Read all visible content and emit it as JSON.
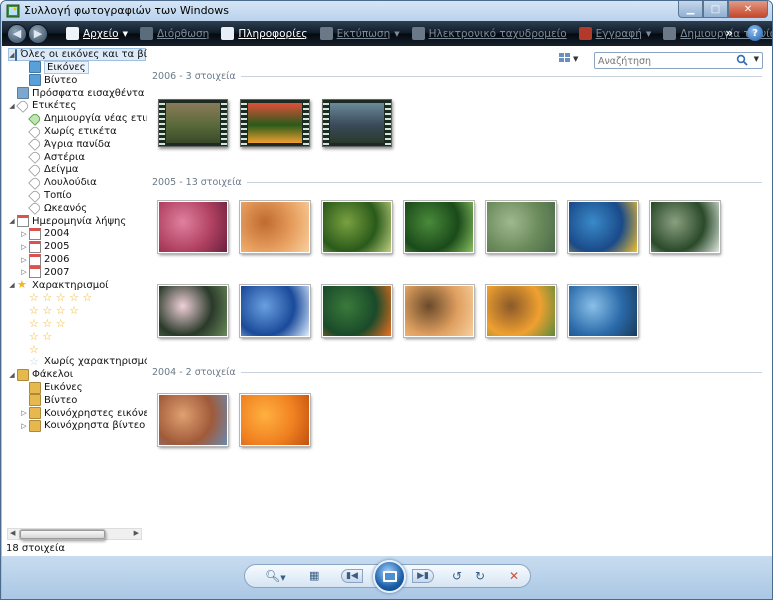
{
  "window": {
    "title": "Συλλογή φωτογραφιών των Windows",
    "controls": [
      "minimize",
      "maximize",
      "close"
    ]
  },
  "toolbar": {
    "items": [
      {
        "label": "Αρχείο",
        "has_dropdown": true,
        "enabled": true,
        "icon": "file-icon"
      },
      {
        "label": "Διόρθωση",
        "has_dropdown": false,
        "enabled": false,
        "icon": "fix-icon"
      },
      {
        "label": "Πληροφορίες",
        "has_dropdown": false,
        "enabled": true,
        "icon": "info-icon"
      },
      {
        "label": "Εκτύπωση",
        "has_dropdown": true,
        "enabled": false,
        "icon": "print-icon"
      },
      {
        "label": "Ηλεκτρονικό ταχυδρομείο",
        "has_dropdown": false,
        "enabled": false,
        "icon": "email-icon"
      },
      {
        "label": "Εγγραφή",
        "has_dropdown": true,
        "enabled": false,
        "icon": "burn-icon"
      },
      {
        "label": "Δημιουργία ταινίας",
        "has_dropdown": false,
        "enabled": false,
        "icon": "movie-icon"
      }
    ],
    "more": "»",
    "help": "?"
  },
  "nav": {
    "rows": [
      {
        "label": "Όλες οι εικόνες και τα βίντεο",
        "level": 0,
        "expander": "▲",
        "icon": "gallery-icon",
        "selected": true
      },
      {
        "label": "Εικόνες",
        "level": 1,
        "icon": "pictures-icon",
        "selected2": true
      },
      {
        "label": "Βίντεο",
        "level": 1,
        "icon": "video-icon"
      },
      {
        "label": "Πρόσφατα εισαχθέντα",
        "level": 0,
        "icon": "recent-icon"
      },
      {
        "label": "Ετικέτες",
        "level": 0,
        "expander": "▲",
        "icon": "tag-icon"
      },
      {
        "label": "Δημιουργία νέας ετικέτας",
        "level": 1,
        "icon": "new-tag-icon"
      },
      {
        "label": "Χωρίς ετικέτα",
        "level": 1,
        "icon": "tag-icon"
      },
      {
        "label": "Άγρια πανίδα",
        "level": 1,
        "icon": "tag-icon"
      },
      {
        "label": "Αστέρια",
        "level": 1,
        "icon": "tag-icon"
      },
      {
        "label": "Δείγμα",
        "level": 1,
        "icon": "tag-icon"
      },
      {
        "label": "Λουλούδια",
        "level": 1,
        "icon": "tag-icon"
      },
      {
        "label": "Τοπίο",
        "level": 1,
        "icon": "tag-icon"
      },
      {
        "label": "Ωκεανός",
        "level": 1,
        "icon": "tag-icon"
      },
      {
        "label": "Ημερομηνία λήψης",
        "level": 0,
        "expander": "▲",
        "icon": "calendar-icon"
      },
      {
        "label": "2004",
        "level": 1,
        "expander": "▷",
        "icon": "calendar-icon"
      },
      {
        "label": "2005",
        "level": 1,
        "expander": "▷",
        "icon": "calendar-icon"
      },
      {
        "label": "2006",
        "level": 1,
        "expander": "▷",
        "icon": "calendar-icon"
      },
      {
        "label": "2007",
        "level": 1,
        "expander": "▷",
        "icon": "calendar-icon"
      },
      {
        "label": "Χαρακτηρισμοί",
        "level": 0,
        "expander": "▲",
        "icon": "star-icon"
      },
      {
        "label": "",
        "level": 1,
        "stars": 5
      },
      {
        "label": "",
        "level": 1,
        "stars": 4
      },
      {
        "label": "",
        "level": 1,
        "stars": 3
      },
      {
        "label": "",
        "level": 1,
        "stars": 2
      },
      {
        "label": "",
        "level": 1,
        "stars": 1
      },
      {
        "label": "Χωρίς χαρακτηρισμό",
        "level": 1,
        "icon": "star-outline-icon"
      },
      {
        "label": "Φάκελοι",
        "level": 0,
        "expander": "▲",
        "icon": "folder-icon"
      },
      {
        "label": "Εικόνες",
        "level": 1,
        "icon": "folder-icon"
      },
      {
        "label": "Βίντεο",
        "level": 1,
        "icon": "folder-icon"
      },
      {
        "label": "Κοινόχρηστες εικόνες",
        "level": 1,
        "expander": "▷",
        "icon": "folder-icon"
      },
      {
        "label": "Κοινόχρηστα βίντεο",
        "level": 1,
        "expander": "▷",
        "icon": "folder-icon"
      }
    ]
  },
  "status": "18 στοιχεία",
  "search": {
    "placeholder": "Αναζήτηση"
  },
  "groups": [
    {
      "label": "2006 - 3 στοιχεία",
      "kind": "video",
      "items": [
        "bear-river",
        "butterfly-flower",
        "lake-landscape"
      ]
    },
    {
      "label": "2005 - 13 στοιχεία",
      "kind": "photo",
      "items": [
        "pink-leaves",
        "desert-oryx",
        "forest-path",
        "green-plants",
        "stream-valley",
        "sea-turtle",
        "waterfall",
        "frangipani",
        "blue-lake",
        "toucan",
        "autumn-tree",
        "sunset-hills",
        "whale-tail"
      ]
    },
    {
      "label": "2004 - 2 στοιχεία",
      "kind": "photo",
      "items": [
        "desert-butte",
        "orange-flowers"
      ]
    }
  ],
  "colors": {
    "toolbar": "#0f1b27",
    "accent": "#1a5fa8",
    "group_text": "#6b7a89"
  }
}
